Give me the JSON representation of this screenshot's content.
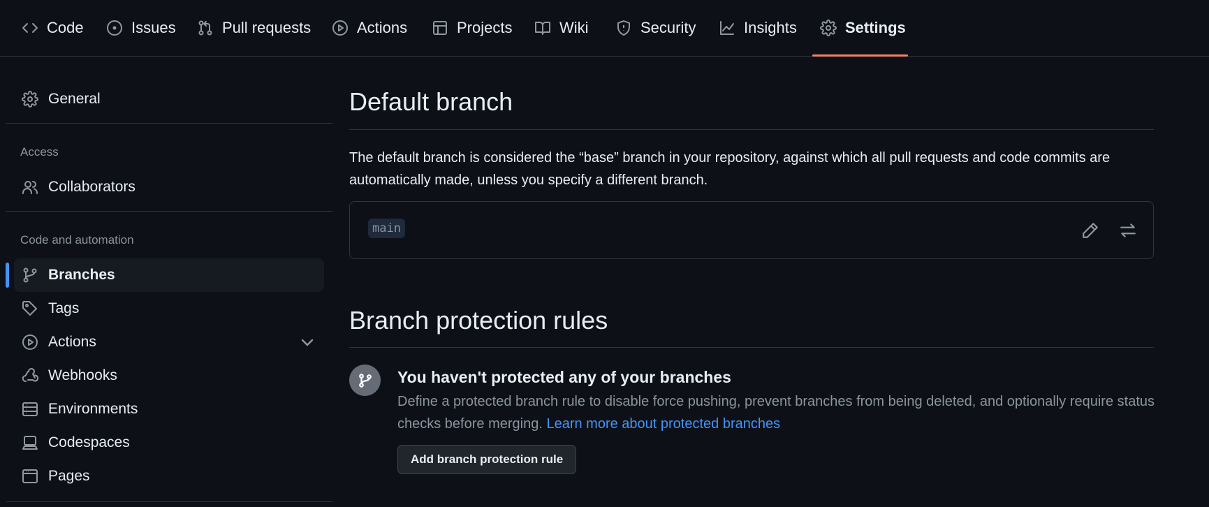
{
  "nav": {
    "tabs": [
      {
        "label": "Code",
        "icon": "code-icon"
      },
      {
        "label": "Issues",
        "icon": "issue-opened-icon"
      },
      {
        "label": "Pull requests",
        "icon": "git-pull-request-icon"
      },
      {
        "label": "Actions",
        "icon": "play-icon"
      },
      {
        "label": "Projects",
        "icon": "table-icon"
      },
      {
        "label": "Wiki",
        "icon": "book-icon"
      },
      {
        "label": "Security",
        "icon": "shield-icon"
      },
      {
        "label": "Insights",
        "icon": "graph-icon"
      },
      {
        "label": "Settings",
        "icon": "gear-icon",
        "active": true
      }
    ],
    "active_color": "#f78166"
  },
  "sidebar": {
    "general": {
      "label": "General",
      "icon": "gear-icon"
    },
    "access_heading": "Access",
    "collaborators": {
      "label": "Collaborators",
      "icon": "people-icon"
    },
    "automation_heading": "Code and automation",
    "items": [
      {
        "label": "Branches",
        "icon": "git-branch-icon",
        "active": true
      },
      {
        "label": "Tags",
        "icon": "tag-icon"
      },
      {
        "label": "Actions",
        "icon": "play-icon",
        "expandable": true
      },
      {
        "label": "Webhooks",
        "icon": "webhook-icon"
      },
      {
        "label": "Environments",
        "icon": "server-icon"
      },
      {
        "label": "Codespaces",
        "icon": "codespaces-icon"
      },
      {
        "label": "Pages",
        "icon": "browser-icon"
      }
    ],
    "accent_color": "#4493f8"
  },
  "default_branch": {
    "title": "Default branch",
    "description": "The default branch is considered the “base” branch in your repository, against which all pull requests and code commits are automatically made, unless you specify a different branch.",
    "branch_name": "main"
  },
  "protection": {
    "title": "Branch protection rules",
    "empty_title": "You haven't protected any of your branches",
    "empty_desc": "Define a protected branch rule to disable force pushing, prevent branches from being deleted, and optionally require status checks before merging.",
    "learn_more": "Learn more about protected branches",
    "add_button": "Add branch protection rule"
  },
  "link_color": "#4493f8"
}
